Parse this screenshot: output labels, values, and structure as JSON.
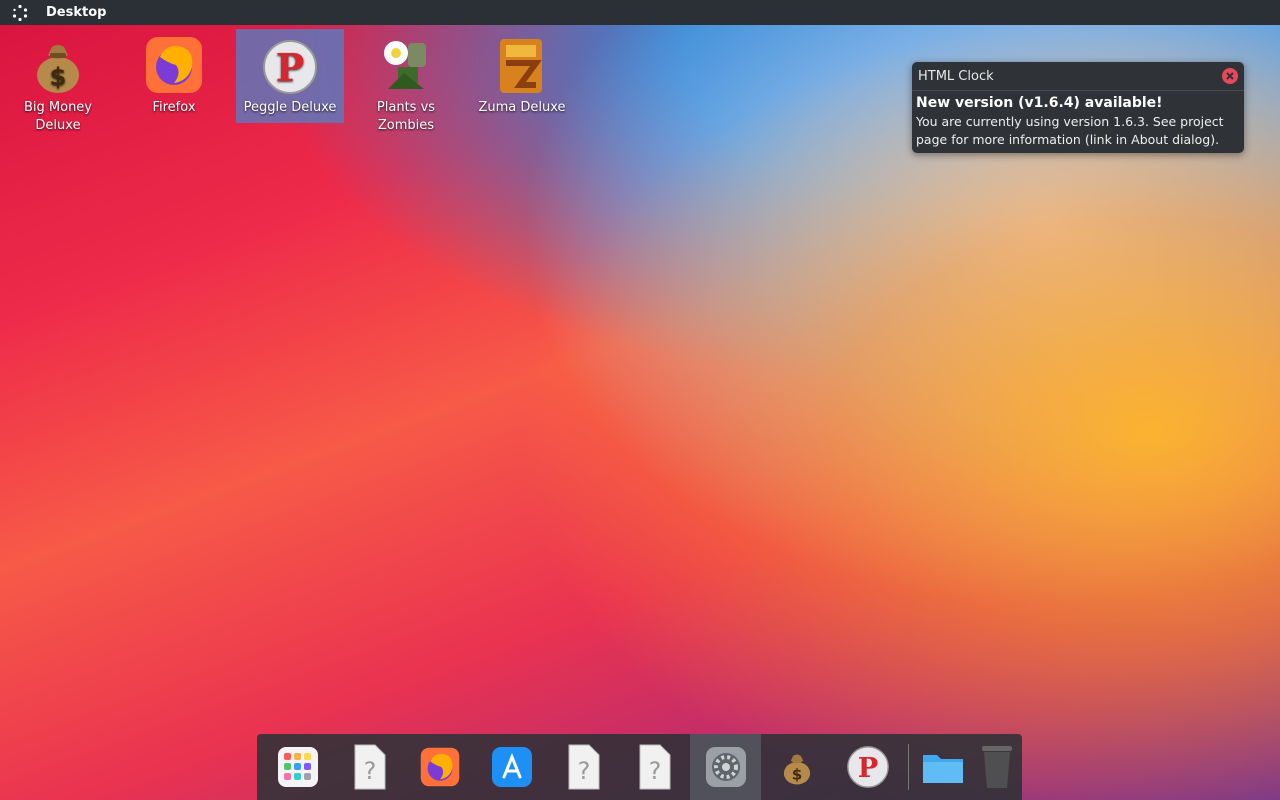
{
  "topbar": {
    "title": "Desktop",
    "launcher_icon": "launcher-icon"
  },
  "desktop": {
    "icons": [
      {
        "label": "Big Money Deluxe",
        "icon": "money-bag-icon"
      },
      {
        "label": "Firefox",
        "icon": "firefox-icon"
      },
      {
        "label": "Peggle Deluxe",
        "icon": "peggle-icon",
        "selected": true
      },
      {
        "label": "Plants vs Zombies",
        "icon": "plants-vs-zombies-icon"
      },
      {
        "label": "Zuma Deluxe",
        "icon": "zuma-icon"
      }
    ]
  },
  "notification": {
    "app": "HTML Clock",
    "heading": "New version (v1.6.4) available!",
    "body": "You are currently using version 1.6.3. See project page for more information (link in About dialog).",
    "close_color": "#e8475c"
  },
  "dock": {
    "items": [
      {
        "name": "launchpad-icon"
      },
      {
        "name": "unknown-file-icon"
      },
      {
        "name": "firefox-icon"
      },
      {
        "name": "app-store-icon"
      },
      {
        "name": "unknown-file-icon"
      },
      {
        "name": "unknown-file-icon"
      },
      {
        "name": "system-settings-icon",
        "active": true
      },
      {
        "name": "money-bag-icon"
      },
      {
        "name": "peggle-icon"
      },
      {
        "name": "folder-icon"
      },
      {
        "name": "trash-icon"
      }
    ]
  }
}
